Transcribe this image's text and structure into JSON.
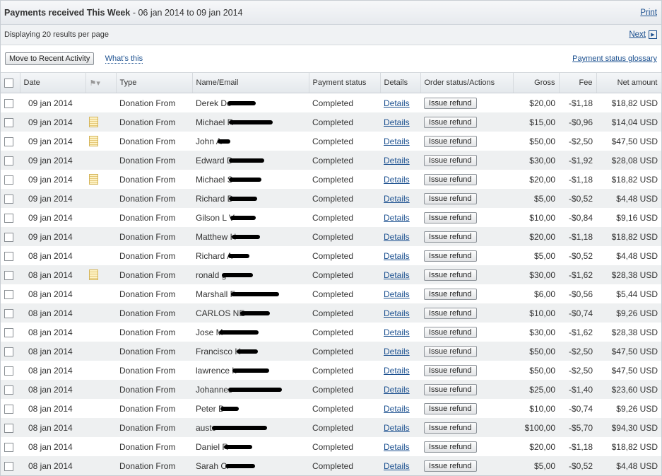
{
  "header": {
    "title": "Payments received This Week",
    "range": " - 06 jan 2014 to 09 jan 2014",
    "print_label": "Print"
  },
  "info": {
    "per_page": "Displaying 20 results per page",
    "next_label": "Next"
  },
  "actions": {
    "move_label": "Move to Recent Activity",
    "whats_this": "What's this",
    "glossary": "Payment status glossary"
  },
  "columns": [
    "Date",
    "",
    "Type",
    "Name/Email",
    "Payment status",
    "Details",
    "Order status/Actions",
    "Gross",
    "Fee",
    "Net amount"
  ],
  "rows": [
    {
      "date": "09 jan 2014",
      "note": false,
      "type": "Donation From",
      "name": "Derek Do",
      "redact": 40,
      "status": "Completed",
      "details": "Details",
      "action": "Issue refund",
      "gross": "$20,00",
      "fee": "-$1,18",
      "net": "$18,82 USD"
    },
    {
      "date": "09 jan 2014",
      "note": true,
      "type": "Donation From",
      "name": "Michael R",
      "redact": 62,
      "status": "Completed",
      "details": "Details",
      "action": "Issue refund",
      "gross": "$15,00",
      "fee": "-$0,96",
      "net": "$14,04 USD"
    },
    {
      "date": "09 jan 2014",
      "note": true,
      "type": "Donation From",
      "name": "John A",
      "redact": 18,
      "status": "Completed",
      "details": "Details",
      "action": "Issue refund",
      "gross": "$50,00",
      "fee": "-$2,50",
      "net": "$47,50 USD"
    },
    {
      "date": "09 jan 2014",
      "note": false,
      "type": "Donation From",
      "name": "Edward D",
      "redact": 50,
      "status": "Completed",
      "details": "Details",
      "action": "Issue refund",
      "gross": "$30,00",
      "fee": "-$1,92",
      "net": "$28,08 USD"
    },
    {
      "date": "09 jan 2014",
      "note": true,
      "type": "Donation From",
      "name": "Michael S",
      "redact": 46,
      "status": "Completed",
      "details": "Details",
      "action": "Issue refund",
      "gross": "$20,00",
      "fee": "-$1,18",
      "net": "$18,82 USD"
    },
    {
      "date": "09 jan 2014",
      "note": false,
      "type": "Donation From",
      "name": "Richard D",
      "redact": 40,
      "status": "Completed",
      "details": "Details",
      "action": "Issue refund",
      "gross": "$5,00",
      "fee": "-$0,52",
      "net": "$4,48 USD"
    },
    {
      "date": "09 jan 2014",
      "note": false,
      "type": "Donation From",
      "name": "Gilson L V",
      "redact": 36,
      "status": "Completed",
      "details": "Details",
      "action": "Issue refund",
      "gross": "$10,00",
      "fee": "-$0,84",
      "net": "$9,16 USD"
    },
    {
      "date": "09 jan 2014",
      "note": false,
      "type": "Donation From",
      "name": "Matthew H",
      "redact": 40,
      "status": "Completed",
      "details": "Details",
      "action": "Issue refund",
      "gross": "$20,00",
      "fee": "-$1,18",
      "net": "$18,82 USD"
    },
    {
      "date": "08 jan 2014",
      "note": false,
      "type": "Donation From",
      "name": "Richard A",
      "redact": 30,
      "status": "Completed",
      "details": "Details",
      "action": "Issue refund",
      "gross": "$5,00",
      "fee": "-$0,52",
      "net": "$4,48 USD"
    },
    {
      "date": "08 jan 2014",
      "note": true,
      "type": "Donation From",
      "name": "ronald g",
      "redact": 44,
      "status": "Completed",
      "details": "Details",
      "action": "Issue refund",
      "gross": "$30,00",
      "fee": "-$1,62",
      "net": "$28,38 USD"
    },
    {
      "date": "08 jan 2014",
      "note": false,
      "type": "Donation From",
      "name": "Marshall F",
      "redact": 68,
      "status": "Completed",
      "details": "Details",
      "action": "Issue refund",
      "gross": "$6,00",
      "fee": "-$0,56",
      "net": "$5,44 USD"
    },
    {
      "date": "08 jan 2014",
      "note": false,
      "type": "Donation From",
      "name": "CARLOS NE",
      "redact": 42,
      "status": "Completed",
      "details": "Details",
      "action": "Issue refund",
      "gross": "$10,00",
      "fee": "-$0,74",
      "net": "$9,26 USD"
    },
    {
      "date": "08 jan 2014",
      "note": false,
      "type": "Donation From",
      "name": "Jose M",
      "redact": 56,
      "status": "Completed",
      "details": "Details",
      "action": "Issue refund",
      "gross": "$30,00",
      "fee": "-$1,62",
      "net": "$28,38 USD"
    },
    {
      "date": "08 jan 2014",
      "note": false,
      "type": "Donation From",
      "name": "Francisco H",
      "redact": 30,
      "status": "Completed",
      "details": "Details",
      "action": "Issue refund",
      "gross": "$50,00",
      "fee": "-$2,50",
      "net": "$47,50 USD"
    },
    {
      "date": "08 jan 2014",
      "note": false,
      "type": "Donation From",
      "name": "lawrence h",
      "redact": 52,
      "status": "Completed",
      "details": "Details",
      "action": "Issue refund",
      "gross": "$50,00",
      "fee": "-$2,50",
      "net": "$47,50 USD"
    },
    {
      "date": "08 jan 2014",
      "note": false,
      "type": "Donation From",
      "name": "Johannes",
      "redact": 76,
      "status": "Completed",
      "details": "Details",
      "action": "Issue refund",
      "gross": "$25,00",
      "fee": "-$1,40",
      "net": "$23,60 USD"
    },
    {
      "date": "08 jan 2014",
      "note": false,
      "type": "Donation From",
      "name": "Peter D",
      "redact": 26,
      "status": "Completed",
      "details": "Details",
      "action": "Issue refund",
      "gross": "$10,00",
      "fee": "-$0,74",
      "net": "$9,26 USD"
    },
    {
      "date": "08 jan 2014",
      "note": false,
      "type": "Donation From",
      "name": "austc",
      "redact": 78,
      "status": "Completed",
      "details": "Details",
      "action": "Issue refund",
      "gross": "$100,00",
      "fee": "-$5,70",
      "net": "$94,30 USD"
    },
    {
      "date": "08 jan 2014",
      "note": false,
      "type": "Donation From",
      "name": "Daniel R",
      "redact": 40,
      "status": "Completed",
      "details": "Details",
      "action": "Issue refund",
      "gross": "$20,00",
      "fee": "-$1,18",
      "net": "$18,82 USD"
    },
    {
      "date": "08 jan 2014",
      "note": false,
      "type": "Donation From",
      "name": "Sarah Cr",
      "redact": 42,
      "status": "Completed",
      "details": "Details",
      "action": "Issue refund",
      "gross": "$5,00",
      "fee": "-$0,52",
      "net": "$4,48 USD"
    }
  ]
}
